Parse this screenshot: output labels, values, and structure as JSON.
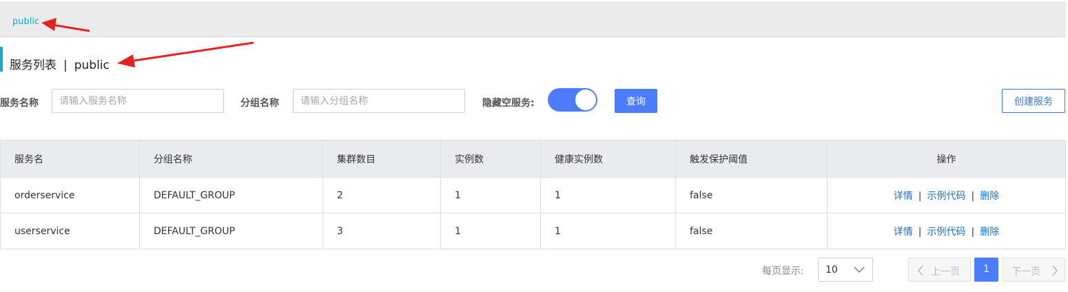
{
  "namespace_bar": {
    "active_namespace": "public"
  },
  "page_title": {
    "main": "服务列表",
    "separator": "|",
    "namespace": "public"
  },
  "filters": {
    "service_name_label": "服务名称",
    "service_name_placeholder": "请输入服务名称",
    "group_name_label": "分组名称",
    "group_name_placeholder": "请输入分组名称",
    "hide_empty_label": "隐藏空服务:",
    "hide_empty_enabled": true,
    "query_button": "查询",
    "create_button": "创建服务"
  },
  "table": {
    "headers": [
      "服务名",
      "分组名称",
      "集群数目",
      "实例数",
      "健康实例数",
      "触发保护阈值",
      "操作"
    ],
    "rows": [
      {
        "service": "orderservice",
        "group": "DEFAULT_GROUP",
        "clusters": "2",
        "instances": "1",
        "healthy": "1",
        "threshold": "false"
      },
      {
        "service": "userservice",
        "group": "DEFAULT_GROUP",
        "clusters": "3",
        "instances": "1",
        "healthy": "1",
        "threshold": "false"
      }
    ],
    "ops": {
      "detail": "详情",
      "sample": "示例代码",
      "delete": "删除",
      "separator": "|"
    }
  },
  "pagination": {
    "per_page_label": "每页显示:",
    "page_size": "10",
    "prev_label": "上一页",
    "current_page": "1",
    "next_label": "下一页"
  },
  "colors": {
    "accent": "#1aa6d6",
    "primary": "#4d7dff",
    "link": "#1e6fc8",
    "arrow": "#e8201f"
  }
}
